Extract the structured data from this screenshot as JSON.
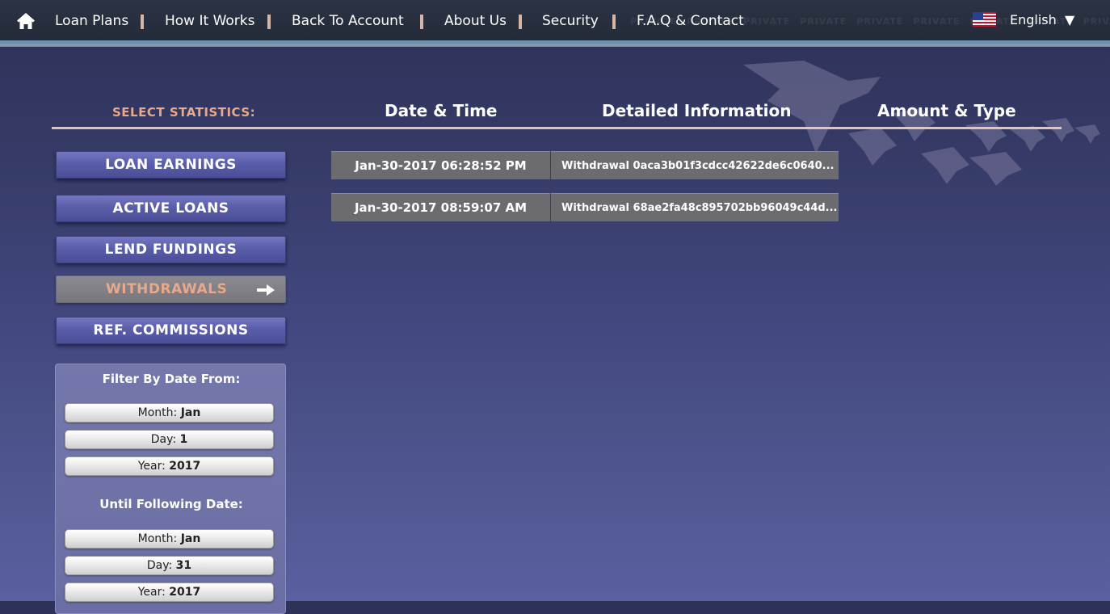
{
  "nav": {
    "items": [
      {
        "label": "Loan Plans"
      },
      {
        "label": "How It Works"
      },
      {
        "label": "Back To Account"
      },
      {
        "label": "About Us"
      },
      {
        "label": "Security"
      },
      {
        "label": "F.A.Q & Contact"
      }
    ],
    "language": "English",
    "watermark": "PRIVATE"
  },
  "header": {
    "select_label": "SELECT STATISTICS:",
    "columns": [
      "Date & Time",
      "Detailed Information",
      "Amount & Type"
    ]
  },
  "sidebar": {
    "buttons": [
      {
        "label": "LOAN EARNINGS"
      },
      {
        "label": "ACTIVE LOANS"
      },
      {
        "label": "LEND FUNDINGS"
      },
      {
        "label": "WITHDRAWALS",
        "active": true
      },
      {
        "label": "REF. COMMISSIONS"
      }
    ]
  },
  "filter": {
    "from_title": "Filter By Date From:",
    "from": {
      "month": {
        "label": "Month:",
        "value": "Jan"
      },
      "day": {
        "label": "Day:",
        "value": "1"
      },
      "year": {
        "label": "Year:",
        "value": "2017"
      }
    },
    "until_title": "Until Following Date:",
    "until": {
      "month": {
        "label": "Month:",
        "value": "Jan"
      },
      "day": {
        "label": "Day:",
        "value": "31"
      },
      "year": {
        "label": "Year:",
        "value": "2017"
      }
    }
  },
  "rows": [
    {
      "date": "Jan-30-2017 06:28:52 PM",
      "info": "Withdrawal 0aca3b01f3cdcc42622de6c0640..."
    },
    {
      "date": "Jan-30-2017 08:59:07 AM",
      "info": "Withdrawal 68ae2fa48c895702bb96049c44d..."
    }
  ],
  "colors": {
    "accent": "#e8a88b",
    "background": "#3a3f6e",
    "button": "#5a5da8",
    "row": "#6c6c70"
  }
}
